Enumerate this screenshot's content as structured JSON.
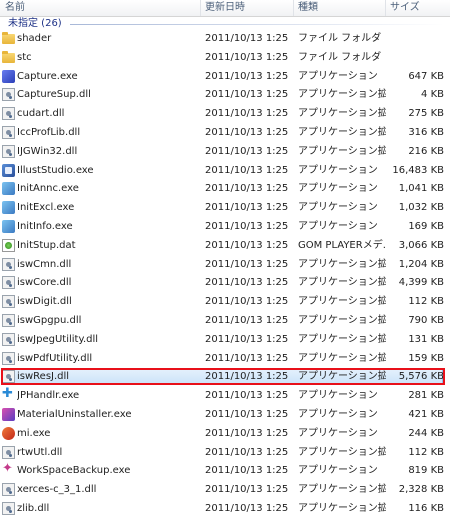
{
  "columns": {
    "name": "名前",
    "date": "更新日時",
    "type": "種類",
    "size": "サイズ"
  },
  "group": {
    "label": "未指定 (26)"
  },
  "files": [
    {
      "name": "shader",
      "date": "2011/10/13 1:25",
      "type": "ファイル フォルダ",
      "size": "",
      "icon": "folder-icon"
    },
    {
      "name": "stc",
      "date": "2011/10/13 1:25",
      "type": "ファイル フォルダ",
      "size": "",
      "icon": "folder-icon"
    },
    {
      "name": "Capture.exe",
      "date": "2011/10/13 1:25",
      "type": "アプリケーション",
      "size": "647 KB",
      "icon": "capture-exe-icon"
    },
    {
      "name": "CaptureSup.dll",
      "date": "2011/10/13 1:25",
      "type": "アプリケーション拡張",
      "size": "4 KB",
      "icon": "dll-icon"
    },
    {
      "name": "cudart.dll",
      "date": "2011/10/13 1:25",
      "type": "アプリケーション拡張",
      "size": "275 KB",
      "icon": "dll-icon"
    },
    {
      "name": "IccProfLib.dll",
      "date": "2011/10/13 1:25",
      "type": "アプリケーション拡張",
      "size": "316 KB",
      "icon": "dll-icon"
    },
    {
      "name": "IJGWin32.dll",
      "date": "2011/10/13 1:25",
      "type": "アプリケーション拡張",
      "size": "216 KB",
      "icon": "dll-icon"
    },
    {
      "name": "IllustStudio.exe",
      "date": "2011/10/13 1:25",
      "type": "アプリケーション",
      "size": "16,483 KB",
      "icon": "illuststudio-exe-icon"
    },
    {
      "name": "InitAnnc.exe",
      "date": "2011/10/13 1:25",
      "type": "アプリケーション",
      "size": "1,041 KB",
      "icon": "init-exe-icon"
    },
    {
      "name": "InitExcl.exe",
      "date": "2011/10/13 1:25",
      "type": "アプリケーション",
      "size": "1,032 KB",
      "icon": "init-exe-icon"
    },
    {
      "name": "InitInfo.exe",
      "date": "2011/10/13 1:25",
      "type": "アプリケーション",
      "size": "169 KB",
      "icon": "init-exe-icon"
    },
    {
      "name": "InitStup.dat",
      "date": "2011/10/13 1:25",
      "type": "GOM PLAYERメデ...",
      "size": "3,066 KB",
      "icon": "dat-icon"
    },
    {
      "name": "iswCmn.dll",
      "date": "2011/10/13 1:25",
      "type": "アプリケーション拡張",
      "size": "1,204 KB",
      "icon": "dll-icon"
    },
    {
      "name": "iswCore.dll",
      "date": "2011/10/13 1:25",
      "type": "アプリケーション拡張",
      "size": "4,399 KB",
      "icon": "dll-icon"
    },
    {
      "name": "iswDigit.dll",
      "date": "2011/10/13 1:25",
      "type": "アプリケーション拡張",
      "size": "112 KB",
      "icon": "dll-icon"
    },
    {
      "name": "iswGpgpu.dll",
      "date": "2011/10/13 1:25",
      "type": "アプリケーション拡張",
      "size": "790 KB",
      "icon": "dll-icon"
    },
    {
      "name": "iswJpegUtility.dll",
      "date": "2011/10/13 1:25",
      "type": "アプリケーション拡張",
      "size": "131 KB",
      "icon": "dll-icon"
    },
    {
      "name": "iswPdfUtility.dll",
      "date": "2011/10/13 1:25",
      "type": "アプリケーション拡張",
      "size": "159 KB",
      "icon": "dll-icon"
    },
    {
      "name": "iswResJ.dll",
      "date": "2011/10/13 1:25",
      "type": "アプリケーション拡張",
      "size": "5,576 KB",
      "icon": "dll-icon",
      "selected": true
    },
    {
      "name": "JPHandlr.exe",
      "date": "2011/10/13 1:25",
      "type": "アプリケーション",
      "size": "281 KB",
      "icon": "jphandlr-exe-icon"
    },
    {
      "name": "MaterialUninstaller.exe",
      "date": "2011/10/13 1:25",
      "type": "アプリケーション",
      "size": "421 KB",
      "icon": "uninstaller-exe-icon"
    },
    {
      "name": "mi.exe",
      "date": "2011/10/13 1:25",
      "type": "アプリケーション",
      "size": "244 KB",
      "icon": "mi-exe-icon"
    },
    {
      "name": "rtwUtl.dll",
      "date": "2011/10/13 1:25",
      "type": "アプリケーション拡張",
      "size": "112 KB",
      "icon": "dll-icon"
    },
    {
      "name": "WorkSpaceBackup.exe",
      "date": "2011/10/13 1:25",
      "type": "アプリケーション",
      "size": "819 KB",
      "icon": "backup-exe-icon"
    },
    {
      "name": "xerces-c_3_1.dll",
      "date": "2011/10/13 1:25",
      "type": "アプリケーション拡張",
      "size": "2,328 KB",
      "icon": "dll-icon"
    },
    {
      "name": "zlib.dll",
      "date": "2011/10/13 1:25",
      "type": "アプリケーション拡張",
      "size": "116 KB",
      "icon": "dll-icon"
    }
  ],
  "colors": {
    "selection_outline": "#e8101a",
    "group_text": "#1e3287",
    "header_text": "#4c607a"
  }
}
